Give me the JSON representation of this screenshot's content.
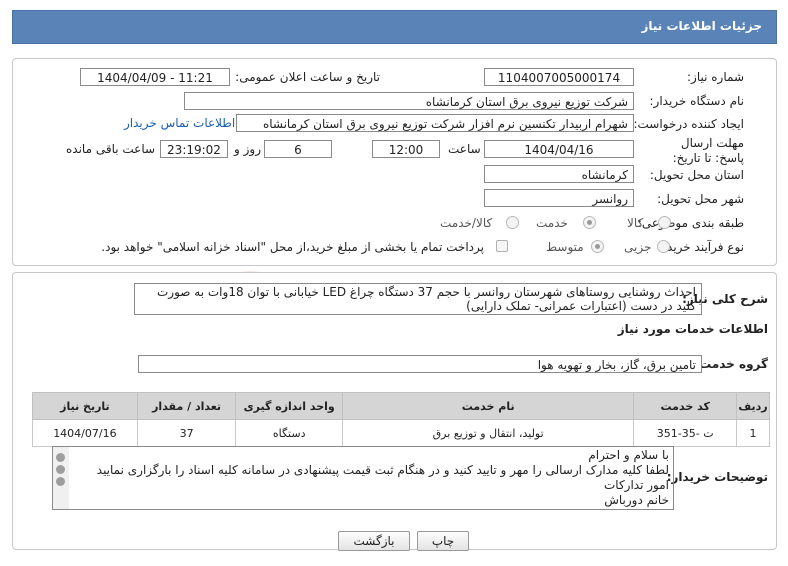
{
  "header": {
    "title": "جزئیات اطلاعات نیاز"
  },
  "fields": {
    "need_number_label": "شماره نیاز:",
    "need_number": "1104007005000174",
    "announce_label": "تاریخ و ساعت اعلان عمومی:",
    "announce_value": "1404/04/09 - 11:21",
    "buyer_org_label": "نام دستگاه خریدار:",
    "buyer_org": "شرکت توزیع نیروی برق استان کرمانشاه",
    "creator_label": "ایجاد کننده درخواست:",
    "creator": "شهرام اربیدار تکنسین نرم افزار شرکت توزیع نیروی برق استان کرمانشاه",
    "contact_link": "اطلاعات تماس خریدار",
    "deadline_label": "مهلت ارسال پاسخ: تا تاریخ:",
    "deadline_date": "1404/04/16",
    "hour_label": "ساعت",
    "deadline_time": "12:00",
    "days_value": "6",
    "days_label": "روز و",
    "remaining_time": "23:19:02",
    "remaining_label": "ساعت باقی مانده",
    "province_label": "استان محل تحویل:",
    "province": "کرمانشاه",
    "city_label": "شهر محل تحویل:",
    "city": "روانسر",
    "category_label": "طبقه بندی موضوعی:",
    "category_options": [
      "کالا",
      "خدمت",
      "کالا/خدمت"
    ],
    "category_selected": "خدمت",
    "process_label": "نوع فرآیند خرید :",
    "process_options": [
      "جزیی",
      "متوسط"
    ],
    "process_selected": "متوسط",
    "payment_note": "پرداخت تمام یا بخشی از مبلغ خرید،از محل \"اسناد خزانه اسلامی\" خواهد بود."
  },
  "summary": {
    "label": "شرح کلی نیاز:",
    "text": "احداث روشنایی روستاهای شهرستان روانسر با حجم 37 دستگاه چراغ LED خیابانی با توان 18وات  به صورت کلید در دست (اعتبارات عمرانی- تملک دارایی)"
  },
  "services": {
    "section_title": "اطلاعات خدمات مورد نیاز",
    "group_label": "گروه خدمت:",
    "group_value": "تامین برق، گاز، بخار و تهویه هوا",
    "columns": [
      "ردیف",
      "کد خدمت",
      "نام خدمت",
      "واحد اندازه گیری",
      "تعداد / مقدار",
      "تاریخ نیاز"
    ],
    "rows": [
      [
        "1",
        "ت -35-351",
        "تولید، انتقال و توزیع برق",
        "دستگاه",
        "37",
        "1404/07/16"
      ]
    ]
  },
  "notes": {
    "label": "توضیحات خریدار:",
    "lines": [
      "با سلام و احترام",
      "لطفا کلیه مدارک ارسالی را مهر و تایید کنید و در هنگام ثبت قیمت پیشنهادی در سامانه کلیه اسناد را بارگزاری نمایید",
      "امور تدارکات",
      "خانم دورباش"
    ]
  },
  "buttons": {
    "print": "چاپ",
    "back": "بازگشت"
  },
  "watermark": "AriaTender.neT",
  "colors": {
    "header": "#5a84b8",
    "link": "#1a5fb4",
    "table_header": "#d5d5d5"
  }
}
